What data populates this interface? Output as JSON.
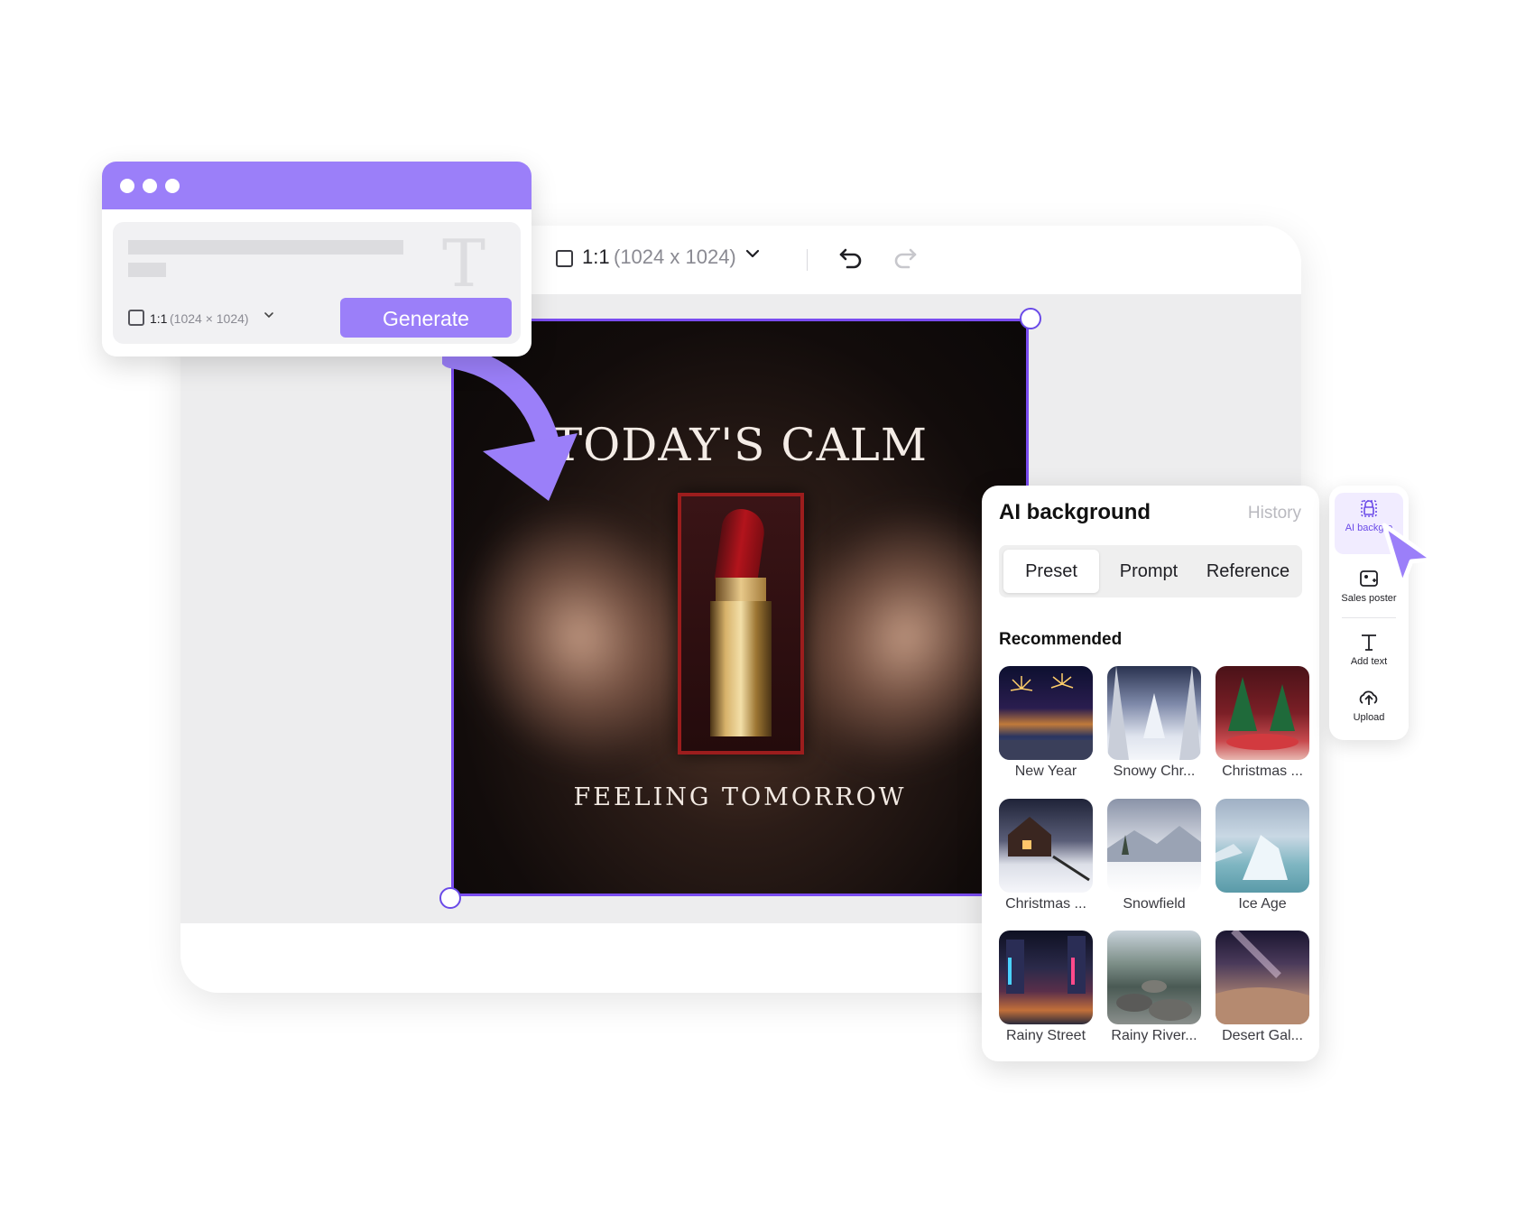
{
  "editor": {
    "ratio_main": "1:1",
    "ratio_dim": "(1024 x 1024)",
    "chevron_icon": "chevron-down-icon",
    "undo_icon": "undo-icon",
    "redo_icon": "redo-icon"
  },
  "poster": {
    "title": "TODAY'S CALM",
    "subtitle": "FEELING TOMORROW"
  },
  "generate_popup": {
    "ratio_main": "1:1",
    "ratio_dim": "(1024 × 1024)",
    "button_label": "Generate",
    "text_glyph": "T"
  },
  "ai_panel": {
    "title": "AI background",
    "history_label": "History",
    "tabs": [
      {
        "label": "Preset",
        "active": true
      },
      {
        "label": "Prompt",
        "active": false
      },
      {
        "label": "Reference",
        "active": false
      }
    ],
    "section_title": "Recommended",
    "presets": [
      {
        "label": "New Year"
      },
      {
        "label": "Snowy Chr..."
      },
      {
        "label": "Christmas ..."
      },
      {
        "label": "Christmas ..."
      },
      {
        "label": "Snowfield"
      },
      {
        "label": "Ice Age"
      },
      {
        "label": "Rainy Street"
      },
      {
        "label": "Rainy River..."
      },
      {
        "label": "Desert Gal..."
      }
    ]
  },
  "side_toolbar": {
    "items": [
      {
        "label": "AI backgro",
        "icon": "ai-background-icon",
        "active": true
      },
      {
        "label": "Sales poster",
        "icon": "sales-poster-icon",
        "active": false
      },
      {
        "label": "Add text",
        "icon": "text-icon",
        "active": false
      },
      {
        "label": "Upload",
        "icon": "upload-cloud-icon",
        "active": false
      }
    ]
  },
  "colors": {
    "accent": "#9b7ff9",
    "selection": "#7a4cf0",
    "workspace": "#ededee"
  }
}
